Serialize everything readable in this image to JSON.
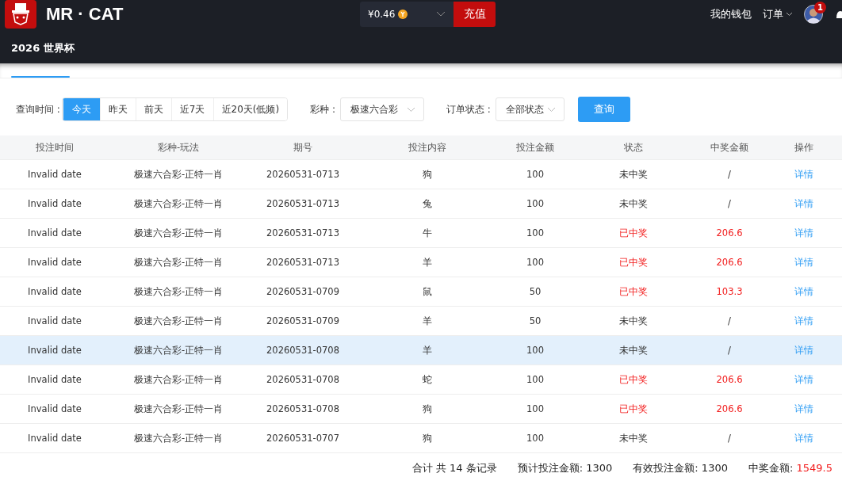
{
  "header": {
    "brand": "MR · CAT",
    "balance": "¥0.46",
    "recharge": "充值",
    "wallet": "我的钱包",
    "orders": "订单",
    "badge": "1",
    "banner": "2026 世界杯"
  },
  "filters": {
    "time_label": "查询时间 :",
    "time_options": [
      {
        "label": "今天",
        "selected": true
      },
      {
        "label": "昨天",
        "selected": false
      },
      {
        "label": "前天",
        "selected": false
      },
      {
        "label": "近7天",
        "selected": false
      },
      {
        "label": "近20天(低频)",
        "selected": false
      }
    ],
    "lottery_label": "彩种 :",
    "lottery_value": "极速六合彩",
    "status_label": "订单状态 :",
    "status_value": "全部状态",
    "query": "查询"
  },
  "table": {
    "columns": [
      "投注时间",
      "彩种-玩法",
      "期号",
      "投注内容",
      "投注金额",
      "状态",
      "中奖金额",
      "操作"
    ],
    "rows": [
      {
        "time": "Invalid date",
        "game": "极速六合彩-正特一肖",
        "issue": "20260531-0713",
        "content": "狗",
        "amount": "100",
        "status": "未中奖",
        "won": false,
        "prize": "/",
        "action": "详情",
        "highlighted": false
      },
      {
        "time": "Invalid date",
        "game": "极速六合彩-正特一肖",
        "issue": "20260531-0713",
        "content": "兔",
        "amount": "100",
        "status": "未中奖",
        "won": false,
        "prize": "/",
        "action": "详情",
        "highlighted": false
      },
      {
        "time": "Invalid date",
        "game": "极速六合彩-正特一肖",
        "issue": "20260531-0713",
        "content": "牛",
        "amount": "100",
        "status": "已中奖",
        "won": true,
        "prize": "206.6",
        "action": "详情",
        "highlighted": false
      },
      {
        "time": "Invalid date",
        "game": "极速六合彩-正特一肖",
        "issue": "20260531-0713",
        "content": "羊",
        "amount": "100",
        "status": "已中奖",
        "won": true,
        "prize": "206.6",
        "action": "详情",
        "highlighted": false
      },
      {
        "time": "Invalid date",
        "game": "极速六合彩-正特一肖",
        "issue": "20260531-0709",
        "content": "鼠",
        "amount": "50",
        "status": "已中奖",
        "won": true,
        "prize": "103.3",
        "action": "详情",
        "highlighted": false
      },
      {
        "time": "Invalid date",
        "game": "极速六合彩-正特一肖",
        "issue": "20260531-0709",
        "content": "羊",
        "amount": "50",
        "status": "未中奖",
        "won": false,
        "prize": "/",
        "action": "详情",
        "highlighted": false
      },
      {
        "time": "Invalid date",
        "game": "极速六合彩-正特一肖",
        "issue": "20260531-0708",
        "content": "羊",
        "amount": "100",
        "status": "未中奖",
        "won": false,
        "prize": "/",
        "action": "详情",
        "highlighted": true
      },
      {
        "time": "Invalid date",
        "game": "极速六合彩-正特一肖",
        "issue": "20260531-0708",
        "content": "蛇",
        "amount": "100",
        "status": "已中奖",
        "won": true,
        "prize": "206.6",
        "action": "详情",
        "highlighted": false
      },
      {
        "time": "Invalid date",
        "game": "极速六合彩-正特一肖",
        "issue": "20260531-0708",
        "content": "狗",
        "amount": "100",
        "status": "已中奖",
        "won": true,
        "prize": "206.6",
        "action": "详情",
        "highlighted": false
      },
      {
        "time": "Invalid date",
        "game": "极速六合彩-正特一肖",
        "issue": "20260531-0707",
        "content": "狗",
        "amount": "100",
        "status": "未中奖",
        "won": false,
        "prize": "/",
        "action": "详情",
        "highlighted": false
      }
    ]
  },
  "summary": {
    "count": "合计 共 14 条记录",
    "expected_label": "预计投注金额:",
    "expected": "1300",
    "valid_label": "有效投注金额:",
    "valid": "1300",
    "prize_label": "中奖金额:",
    "prize": "1549.5"
  }
}
